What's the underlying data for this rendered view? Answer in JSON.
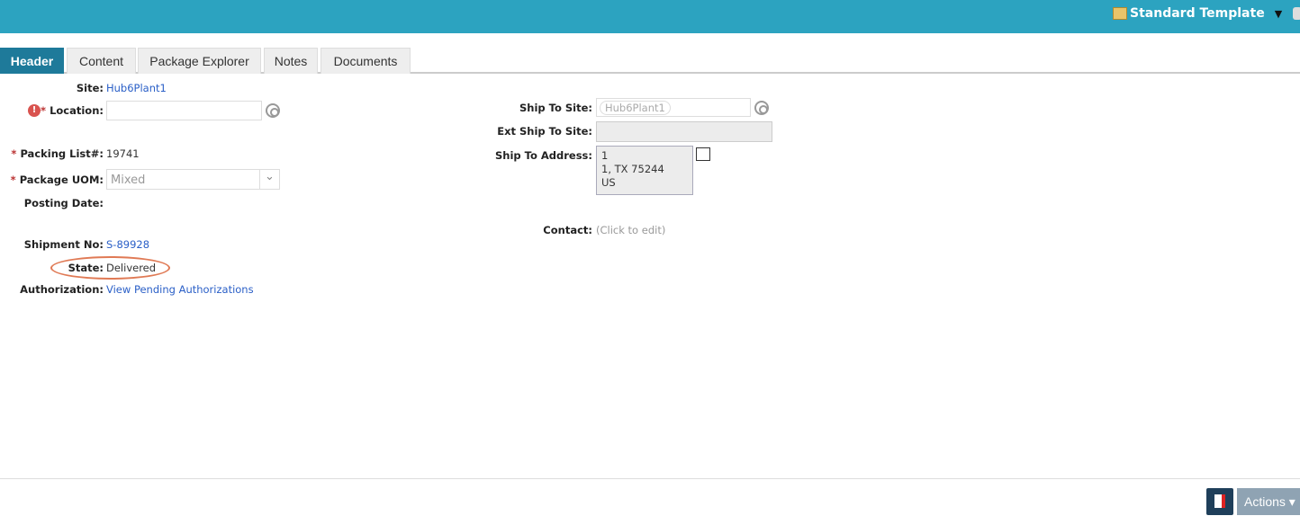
{
  "header": {
    "template": "Standard Template"
  },
  "tabs": [
    "Header",
    "Content",
    "Package Explorer",
    "Notes",
    "Documents"
  ],
  "left": {
    "site_label": "Site:",
    "site": "Hub6Plant1",
    "location_label": "Location:",
    "location": "",
    "packing_label": "Packing List#:",
    "packing": "19741",
    "uom_label": "Package UOM:",
    "uom": "Mixed",
    "posting_label": "Posting Date:",
    "shipment_label": "Shipment No:",
    "shipment": "S-89928",
    "state_label": "State:",
    "state": "Delivered",
    "auth_label": "Authorization:",
    "auth": "View Pending Authorizations"
  },
  "right": {
    "shipsite_label": "Ship To Site:",
    "shipsite": "Hub6Plant1",
    "ext_label": "Ext Ship To Site:",
    "addr_label": "Ship To Address:",
    "addr": [
      "1",
      "1, TX 75244",
      "US"
    ],
    "contact_label": "Contact:",
    "contact": "(Click to edit)"
  },
  "footer": {
    "actions": "Actions ▾"
  }
}
